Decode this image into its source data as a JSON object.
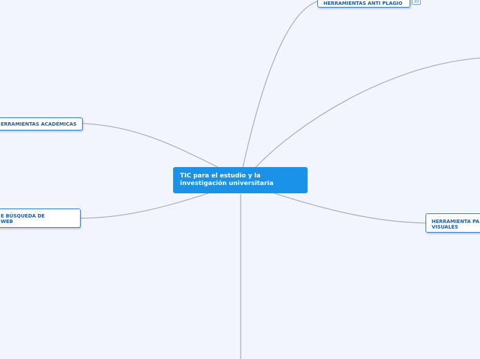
{
  "map": {
    "central": {
      "line1": "TIC para el estudio y la",
      "line2": "investigación universitaria"
    },
    "topics": {
      "anti_plagio": {
        "label": "HERRAMIENTAS ANTI PLAGIO",
        "badge": "30"
      },
      "academicas": {
        "label": "ERRAMIENTAS ACADÉMICAS"
      },
      "busqueda": {
        "line1": "E BÚSQUEDA DE",
        "line2": "WEB"
      },
      "visuales": {
        "line1": "HERRAMIENTA PA",
        "line2": "VISUALES"
      }
    }
  },
  "colors": {
    "background": "#f2f5fd",
    "central_fill": "#1a92e8",
    "topic_border": "#2f7fd0",
    "topic_text": "#1b5da8",
    "connector": "#aab0bd"
  }
}
